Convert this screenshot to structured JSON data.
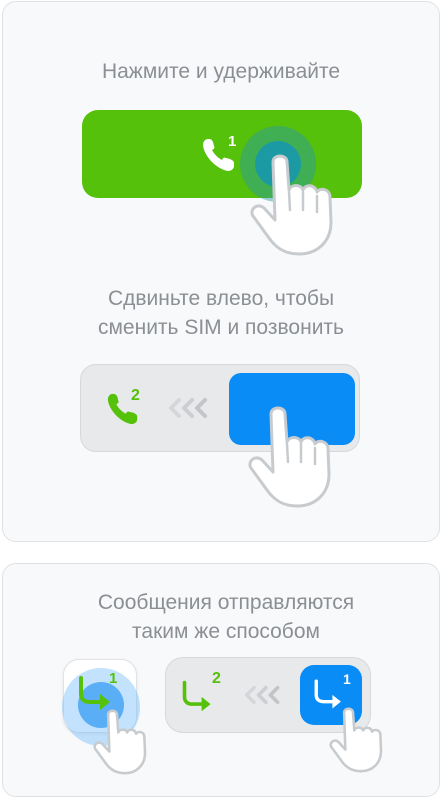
{
  "step1": {
    "caption": "Нажмите и удерживайте",
    "sim": "1"
  },
  "step2": {
    "caption": "Сдвиньте влево, чтобы\nсменить SIM и позвонить",
    "sim": "2"
  },
  "step3": {
    "caption": "Сообщения отправляются\nтаким же способом",
    "sim_left": "1",
    "sim_right": "2",
    "sim_button": "1"
  },
  "colors": {
    "green": "#55c10b",
    "blue": "#0a8cf7",
    "teal": "#1c9aa3",
    "track": "#e8e9eb",
    "caption": "#8b8f93"
  }
}
